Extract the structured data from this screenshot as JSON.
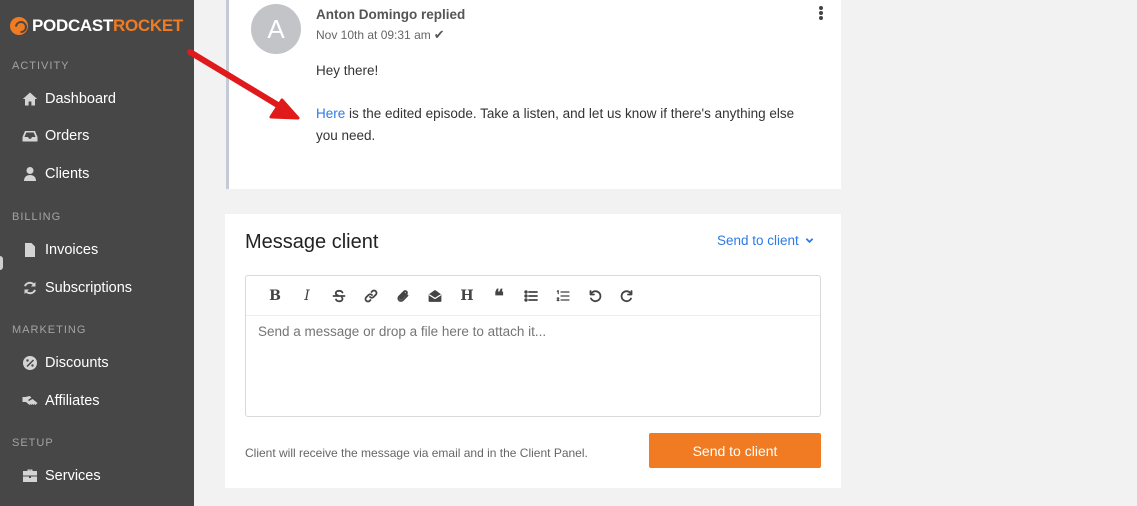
{
  "brand": {
    "part1": "PODCAST",
    "part2": "ROCKET",
    "accent": "#f07b22"
  },
  "sidebar": {
    "sections": [
      {
        "label": "ACTIVITY"
      },
      {
        "label": "BILLING"
      },
      {
        "label": "MARKETING"
      },
      {
        "label": "SETUP"
      }
    ],
    "items": [
      {
        "label": "Dashboard",
        "icon": "home-icon"
      },
      {
        "label": "Orders",
        "icon": "inbox-icon"
      },
      {
        "label": "Clients",
        "icon": "user-icon"
      },
      {
        "label": "Invoices",
        "icon": "file-icon"
      },
      {
        "label": "Subscriptions",
        "icon": "refresh-icon"
      },
      {
        "label": "Discounts",
        "icon": "percent-icon"
      },
      {
        "label": "Affiliates",
        "icon": "handshake-icon"
      },
      {
        "label": "Services",
        "icon": "briefcase-icon"
      }
    ]
  },
  "reply": {
    "avatar_initial": "A",
    "author": "Anton Domingo replied",
    "timestamp": "Nov 10th at 09:31 am",
    "greeting": "Hey there!",
    "link_text": "Here",
    "body_rest": " is the edited episode. Take a listen, and let us know if there's anything else you need."
  },
  "message": {
    "title": "Message client",
    "dropdown_label": "Send to client",
    "placeholder": "Send a message or drop a file here to attach it...",
    "toolbar": [
      "bold-icon",
      "italic-icon",
      "strikethrough-icon",
      "link-icon",
      "paperclip-icon",
      "envelope-icon",
      "heading-icon",
      "quote-icon",
      "bullet-list-icon",
      "numbered-list-icon",
      "undo-icon",
      "redo-icon"
    ],
    "hint": "Client will receive the message via email and in the Client Panel.",
    "send_button": "Send to client"
  },
  "colors": {
    "sidebar_bg": "#474747",
    "link": "#2d7be5",
    "button": "#f07b22",
    "annotation_arrow": "#e0191b"
  }
}
